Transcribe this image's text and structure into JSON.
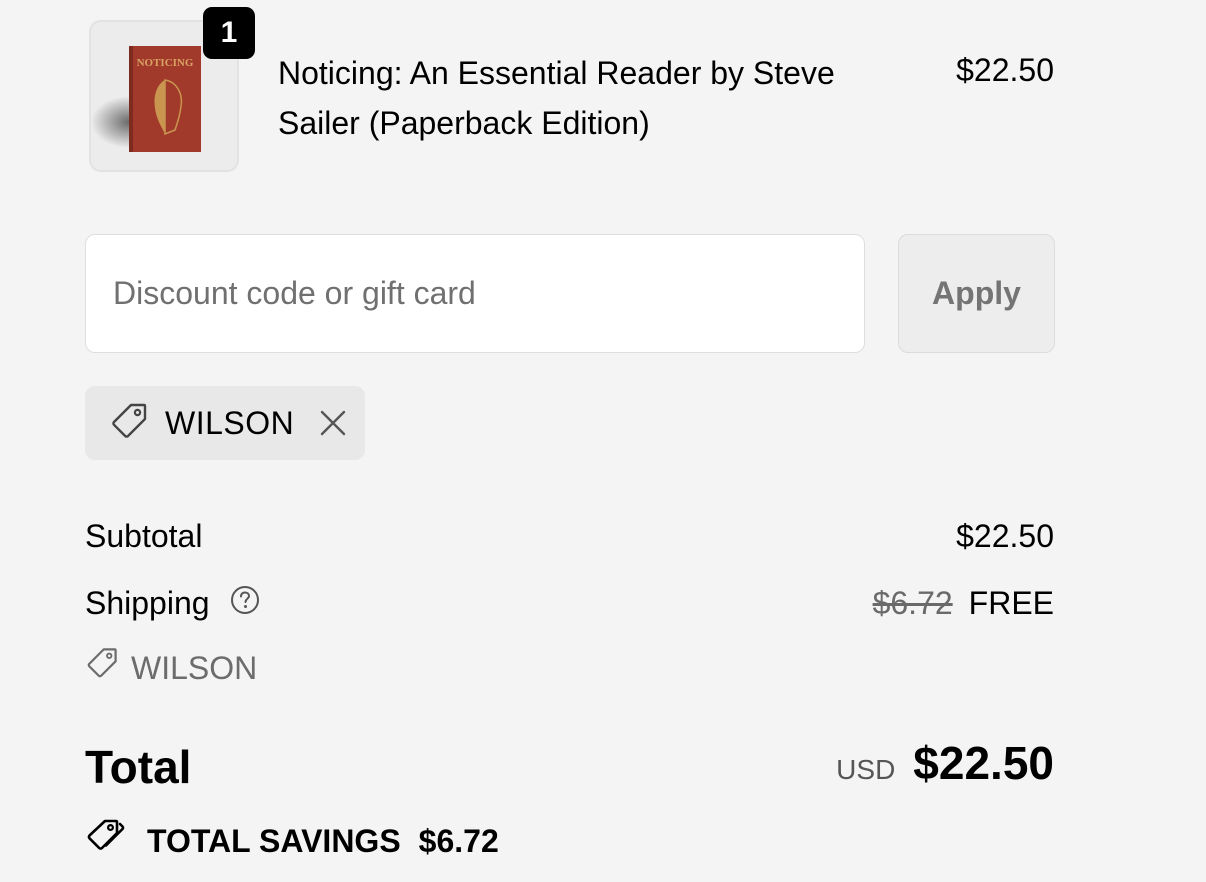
{
  "cart": {
    "items": [
      {
        "quantity": "1",
        "title": "Noticing: An Essential Reader by Steve Sailer (Paperback Edition)",
        "price": "$22.50",
        "cover_text": "NOTICING"
      }
    ]
  },
  "discount": {
    "placeholder": "Discount code or gift card",
    "value": "",
    "apply_label": "Apply",
    "applied_code": "WILSON"
  },
  "summary": {
    "subtotal_label": "Subtotal",
    "subtotal_value": "$22.50",
    "shipping_label": "Shipping",
    "shipping_original": "$6.72",
    "shipping_value": "FREE",
    "shipping_discount_code": "WILSON",
    "total_label": "Total",
    "currency": "USD",
    "total_value": "$22.50",
    "savings_label": "TOTAL SAVINGS",
    "savings_value": "$6.72"
  },
  "colors": {
    "background": "#f4f4f4",
    "badge": "#000000",
    "book_cover": "#a23a2c",
    "book_gold": "#c9954f"
  }
}
